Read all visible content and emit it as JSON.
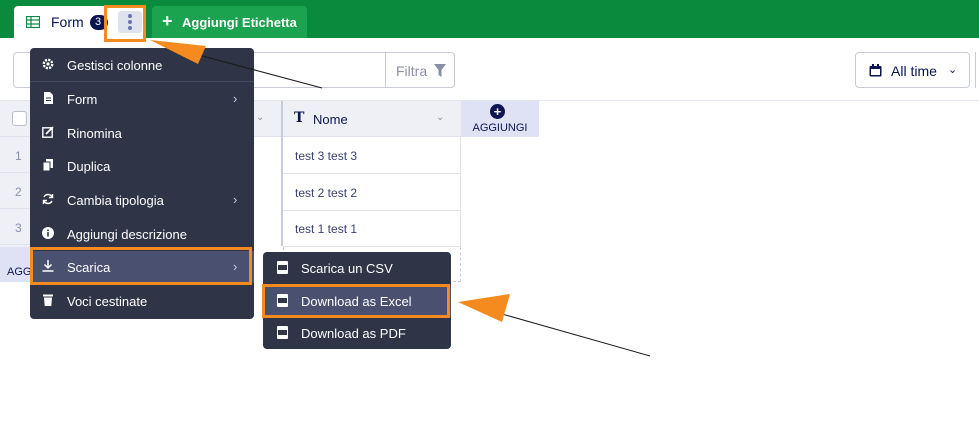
{
  "tabs": {
    "form_label": "Form",
    "form_count": "3",
    "add_label": "Aggiungi Etichetta"
  },
  "toolbar": {
    "search_placeholder": "",
    "filter_label": "Filtra",
    "time_filter_label": "All time"
  },
  "table": {
    "column_name_label": "Nome",
    "add_column_label": "AGGIUNGI",
    "row_numbers": [
      "1",
      "2",
      "3"
    ],
    "rows": [
      "test 3 test 3",
      "test 2 test 2",
      "test 1 test 1"
    ],
    "aggregate_label_partial": "AGG"
  },
  "context_menu": {
    "items": [
      {
        "label": "Gestisci colonne",
        "icon": "gear-icon"
      },
      {
        "label": "Form",
        "icon": "document-icon",
        "submenu": true
      },
      {
        "label": "Rinomina",
        "icon": "edit-icon"
      },
      {
        "label": "Duplica",
        "icon": "copy-icon"
      },
      {
        "label": "Cambia tipologia",
        "icon": "refresh-icon",
        "submenu": true
      },
      {
        "label": "Aggiungi descrizione",
        "icon": "info-icon"
      },
      {
        "label": "Scarica",
        "icon": "download-icon",
        "submenu": true
      },
      {
        "label": "Voci cestinate",
        "icon": "trash-icon"
      }
    ]
  },
  "download_submenu": {
    "items": [
      {
        "label": "Scarica un CSV",
        "icon": "csv-file-icon"
      },
      {
        "label": "Download as Excel",
        "icon": "excel-file-icon"
      },
      {
        "label": "Download as PDF",
        "icon": "pdf-file-icon"
      }
    ]
  },
  "colors": {
    "topbar": "#0a8a3c",
    "add_button": "#1ba34f",
    "menu_bg": "#2f3446",
    "highlight": "#f58a1f"
  }
}
